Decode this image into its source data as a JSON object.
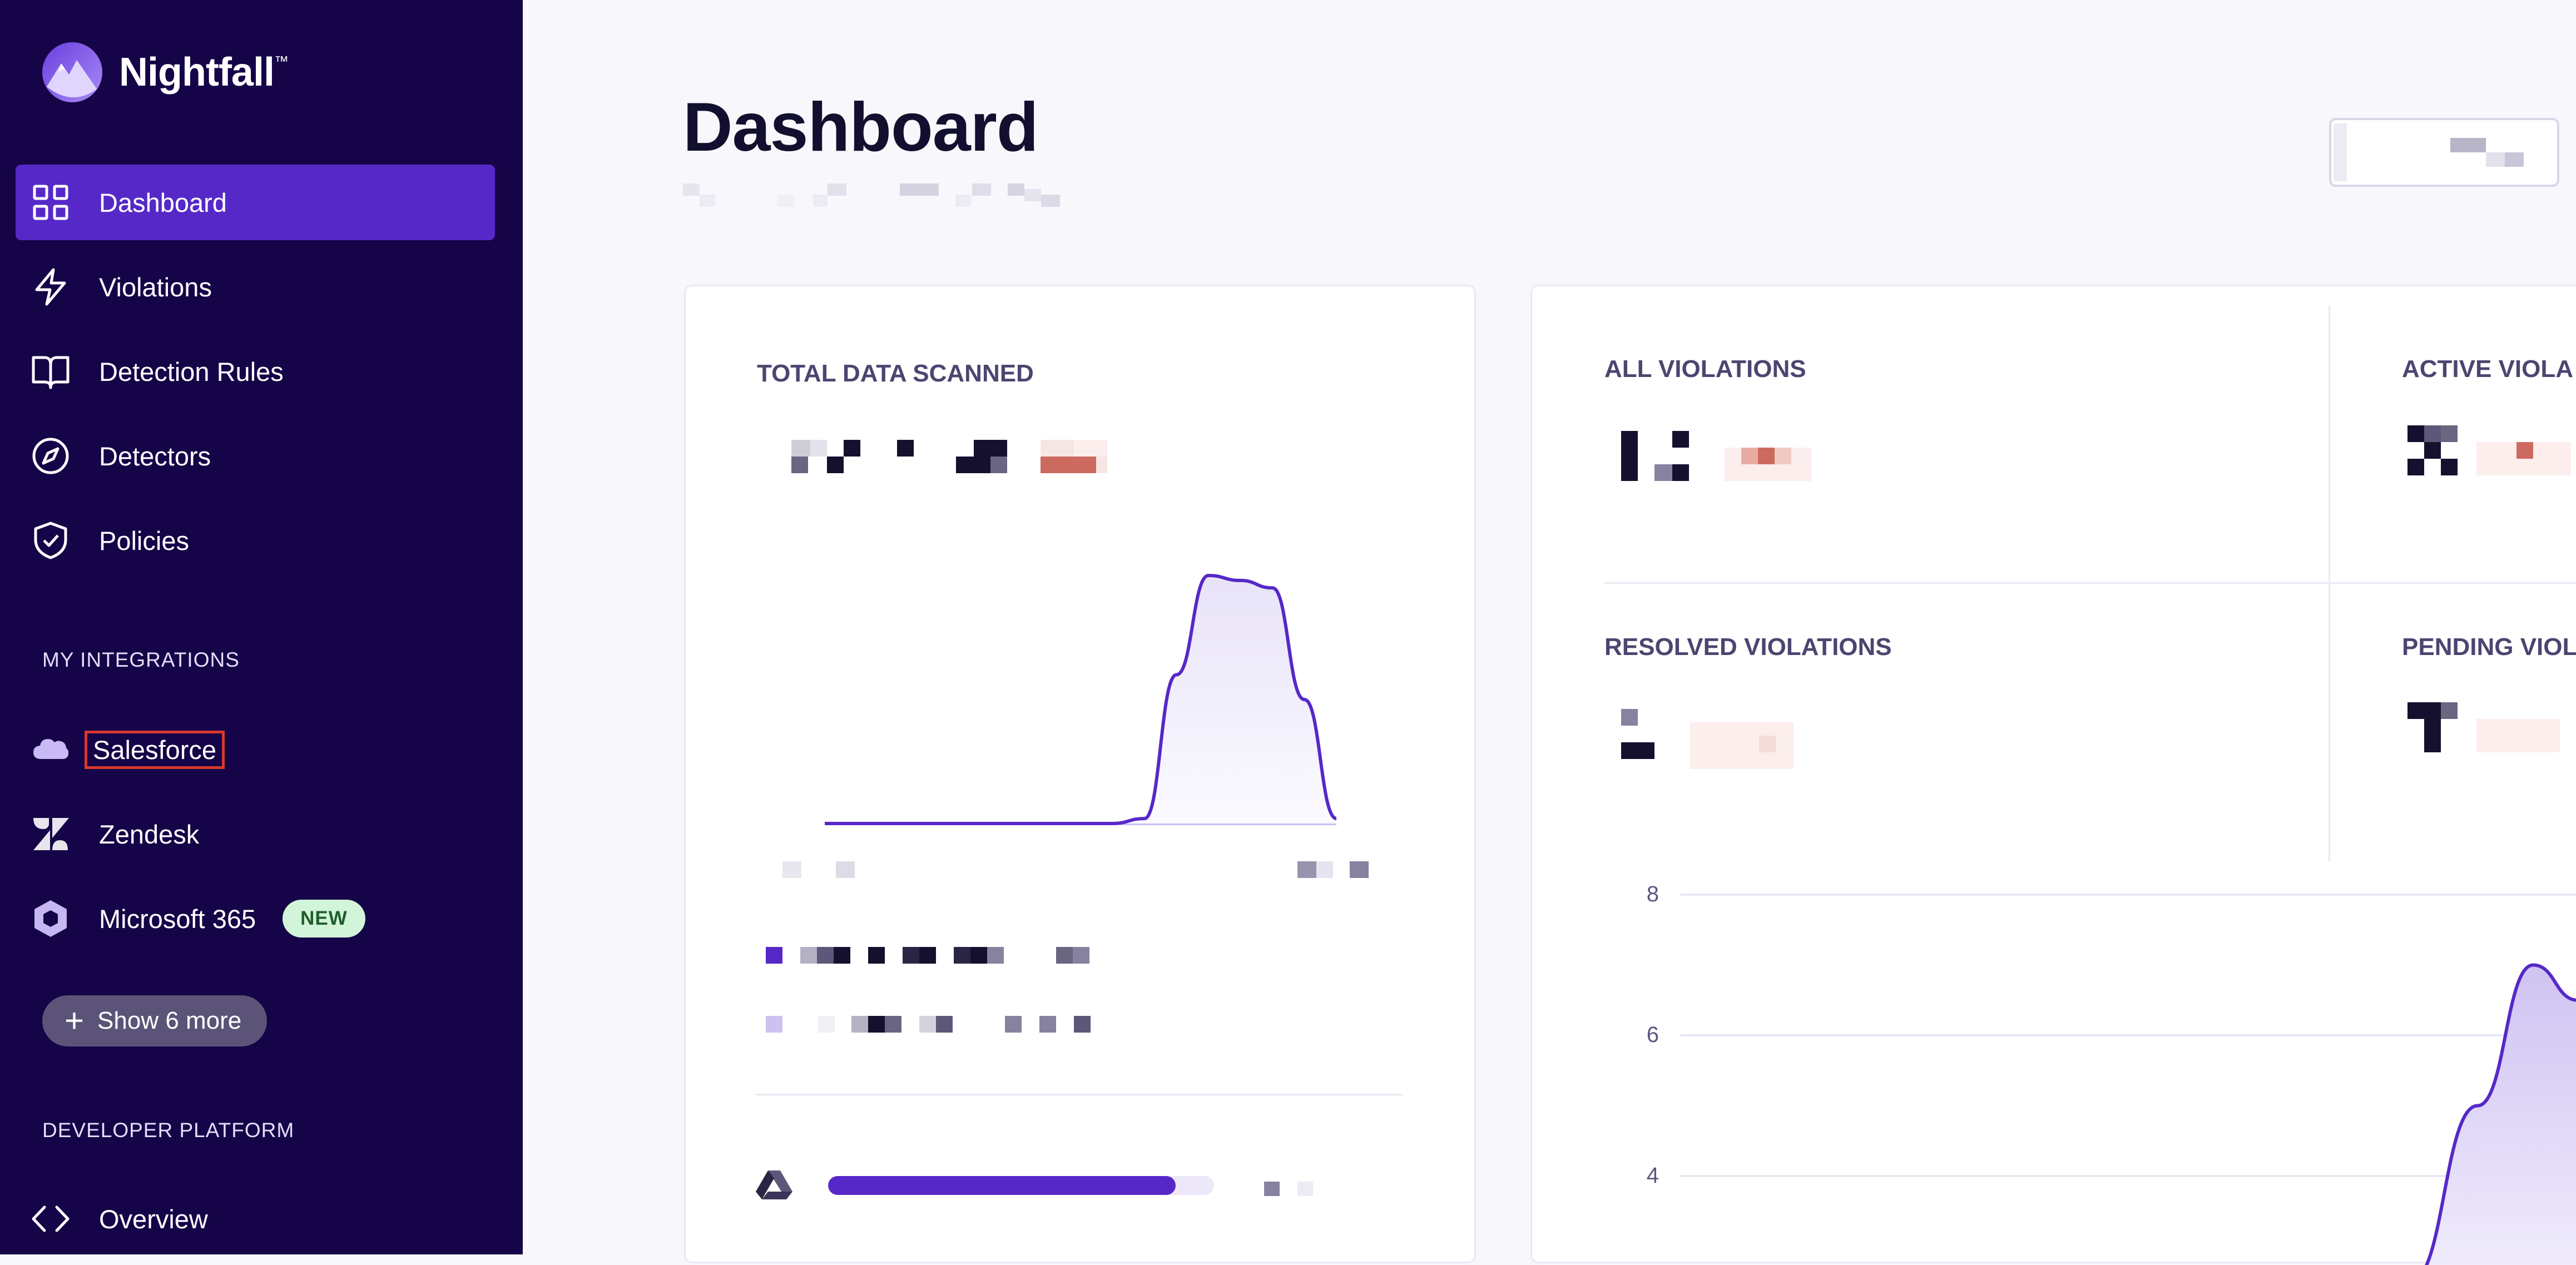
{
  "brand": {
    "name": "Nightfall",
    "trademark": "™"
  },
  "sidebar": {
    "nav": [
      {
        "label": "Dashboard",
        "icon": "grid-icon",
        "active": true
      },
      {
        "label": "Violations",
        "icon": "lightning-icon",
        "active": false
      },
      {
        "label": "Detection Rules",
        "icon": "book-icon",
        "active": false
      },
      {
        "label": "Detectors",
        "icon": "compass-icon",
        "active": false
      },
      {
        "label": "Policies",
        "icon": "shield-check-icon",
        "active": false
      }
    ],
    "integrations_heading": "MY INTEGRATIONS",
    "integrations": [
      {
        "label": "Salesforce",
        "icon": "salesforce-cloud-icon",
        "highlighted": true
      },
      {
        "label": "Zendesk",
        "icon": "zendesk-icon"
      },
      {
        "label": "Microsoft 365",
        "icon": "microsoft-365-icon",
        "badge": "NEW"
      }
    ],
    "show_more": {
      "label": "Show 6 more",
      "icon": "plus-icon"
    },
    "developer_heading": "DEVELOPER PLATFORM",
    "developer": [
      {
        "label": "Overview",
        "icon": "code-brackets-icon"
      }
    ]
  },
  "main": {
    "title": "Dashboard",
    "cards": {
      "total_data_scanned": {
        "heading": "TOTAL DATA SCANNED",
        "integration_icon": "google-drive-icon",
        "progress": 0.9
      },
      "all_violations": {
        "heading": "ALL VIOLATIONS"
      },
      "active_violations": {
        "heading": "ACTIVE VIOLA"
      },
      "resolved_violations": {
        "heading": "RESOLVED VIOLATIONS"
      },
      "pending_violations": {
        "heading": "PENDING VIOL"
      }
    }
  },
  "chart_data": [
    {
      "type": "area",
      "title": "",
      "x": [
        0,
        1,
        2,
        3,
        4,
        5,
        6,
        7,
        8,
        9,
        10,
        11,
        12,
        13,
        14,
        15,
        16
      ],
      "series": [
        {
          "values": [
            0,
            0,
            0,
            0,
            0,
            0,
            0,
            0,
            0,
            0,
            0.02,
            0.6,
            1.0,
            0.98,
            0.95,
            0.5,
            0.02
          ]
        }
      ]
    },
    {
      "type": "area",
      "title": "",
      "yticks": [
        4,
        6,
        8
      ],
      "ylim": [
        3.3,
        8.3
      ],
      "series": [
        {
          "values": [
            2.5,
            5.0,
            7.0,
            6.5
          ]
        }
      ]
    }
  ]
}
